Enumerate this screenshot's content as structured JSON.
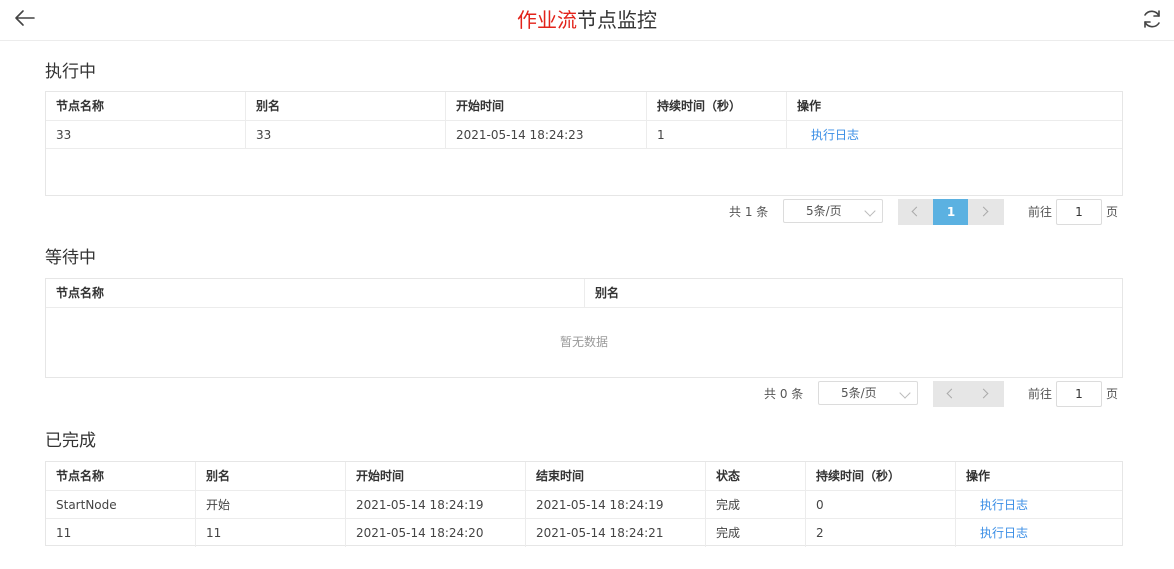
{
  "header": {
    "title_accent": "作业流",
    "title_rest": "节点监控",
    "back_icon": "arrow-left-icon",
    "refresh_icon": "refresh-icon"
  },
  "running": {
    "title": "执行中",
    "columns": [
      "节点名称",
      "别名",
      "开始时间",
      "持续时间（秒）",
      "操作"
    ],
    "rows": [
      {
        "name": "33",
        "alias": "33",
        "start": "2021-05-14 18:24:23",
        "duration": "1",
        "action": "执行日志"
      }
    ],
    "pager": {
      "total": "共 1 条",
      "page_size": "5条/页",
      "current_page": "1",
      "goto_label": "前往",
      "goto_value": "1",
      "page_suffix": "页"
    }
  },
  "waiting": {
    "title": "等待中",
    "columns": [
      "节点名称",
      "别名"
    ],
    "empty_text": "暂无数据",
    "pager": {
      "total": "共 0 条",
      "page_size": "5条/页",
      "goto_label": "前往",
      "goto_value": "1",
      "page_suffix": "页"
    }
  },
  "completed": {
    "title": "已完成",
    "columns": [
      "节点名称",
      "别名",
      "开始时间",
      "结束时间",
      "状态",
      "持续时间（秒）",
      "操作"
    ],
    "rows": [
      {
        "name": "StartNode",
        "alias": "开始",
        "start": "2021-05-14 18:24:19",
        "end": "2021-05-14 18:24:19",
        "status": "完成",
        "duration": "0",
        "action": "执行日志"
      },
      {
        "name": "11",
        "alias": "11",
        "start": "2021-05-14 18:24:20",
        "end": "2021-05-14 18:24:21",
        "status": "完成",
        "duration": "2",
        "action": "执行日志"
      }
    ]
  },
  "colors": {
    "accent": "#e2231a",
    "link": "#3a8ee6",
    "active_page": "#5bb1e1"
  }
}
